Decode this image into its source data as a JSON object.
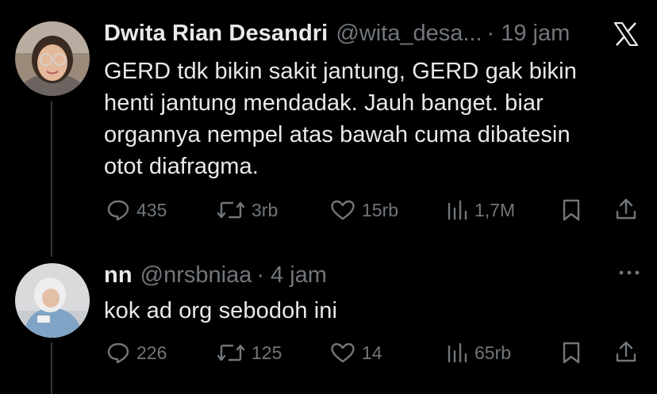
{
  "tweets": [
    {
      "author_name": "Dwita Rian Desandri",
      "handle": "@wita_desa...",
      "time": "· 19 jam",
      "text_lines": [
        "GERD tdk bikin sakit jantung, GERD gak bikin",
        "henti jantung mendadak. Jauh banget. biar",
        "organnya nempel atas bawah cuma dibatesin",
        "otot diafragma."
      ],
      "replies": "435",
      "reposts": "3rb",
      "likes": "15rb",
      "views": "1,7M"
    },
    {
      "author_name": "nn",
      "handle": "@nrsbniaa",
      "time": "· 4 jam",
      "text_lines": [
        "kok ad org sebodoh ini"
      ],
      "replies": "226",
      "reposts": "125",
      "likes": "14",
      "views": "65rb"
    }
  ],
  "icons": {
    "brand": "x-logo-icon",
    "more": "more-options-icon",
    "reply": "reply-icon",
    "repost": "repost-icon",
    "like": "like-icon",
    "views": "views-icon",
    "bookmark": "bookmark-icon",
    "share": "share-icon"
  },
  "colors": {
    "background": "#000000",
    "text": "#e7e9ea",
    "muted": "#71767b",
    "thread_line": "#333639"
  }
}
